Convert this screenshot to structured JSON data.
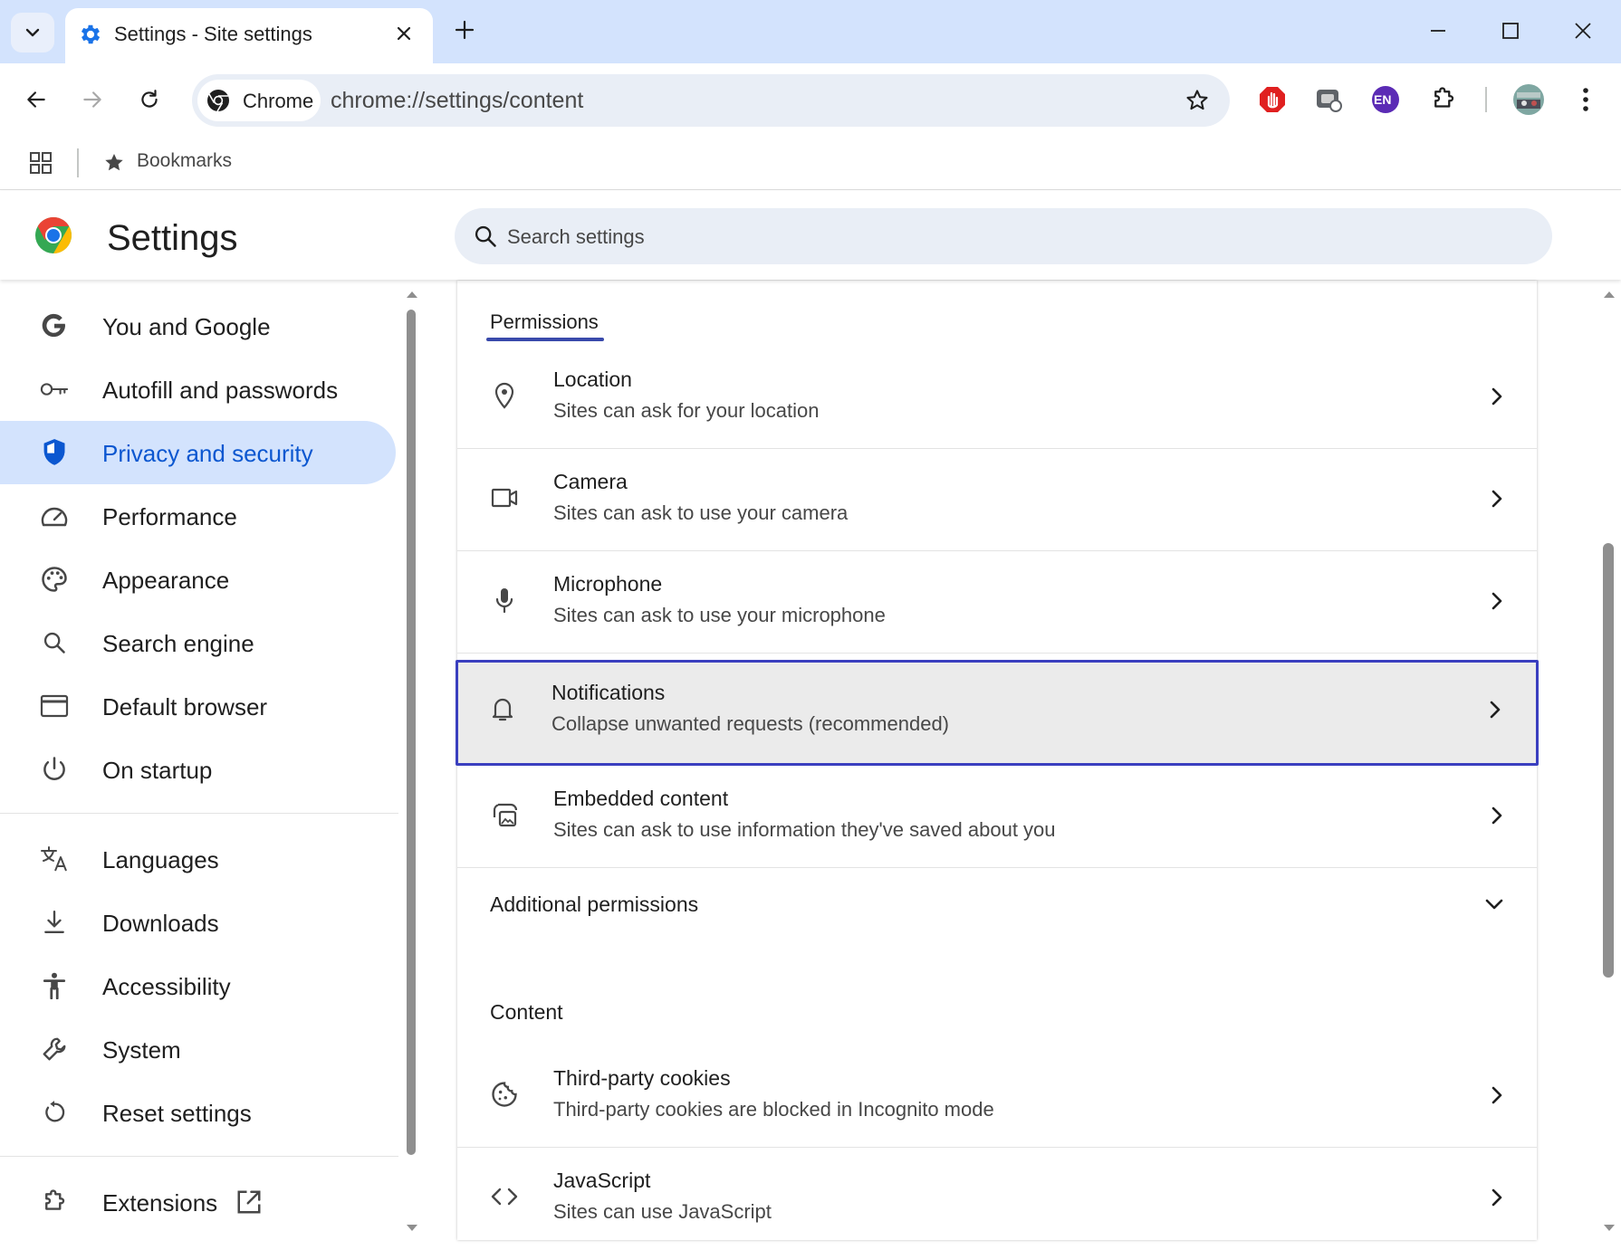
{
  "browser": {
    "tab": {
      "title": "Settings - Site settings"
    },
    "omnibox": {
      "chip_label": "Chrome",
      "url": "chrome://settings/content"
    },
    "extensions": [
      "adblock-extension",
      "screen-capture-extension",
      "language-extension",
      "extensions-puzzle"
    ],
    "language_badge": "EN",
    "bookmarks_label": "Bookmarks"
  },
  "settings": {
    "title": "Settings",
    "search_placeholder": "Search settings"
  },
  "sidebar": {
    "items": [
      {
        "label": "You and Google",
        "icon": "google-g-icon"
      },
      {
        "label": "Autofill and passwords",
        "icon": "key-icon"
      },
      {
        "label": "Privacy and security",
        "icon": "shield-icon",
        "active": true
      },
      {
        "label": "Performance",
        "icon": "speedometer-icon"
      },
      {
        "label": "Appearance",
        "icon": "palette-icon"
      },
      {
        "label": "Search engine",
        "icon": "search-icon"
      },
      {
        "label": "Default browser",
        "icon": "browser-window-icon"
      },
      {
        "label": "On startup",
        "icon": "power-icon"
      },
      {
        "label": "Languages",
        "icon": "translate-icon"
      },
      {
        "label": "Downloads",
        "icon": "download-icon"
      },
      {
        "label": "Accessibility",
        "icon": "accessibility-icon"
      },
      {
        "label": "System",
        "icon": "wrench-icon"
      },
      {
        "label": "Reset settings",
        "icon": "reset-icon"
      },
      {
        "label": "Extensions",
        "icon": "puzzle-icon"
      }
    ]
  },
  "main": {
    "permissions_heading": "Permissions",
    "permissions": [
      {
        "title": "Location",
        "subtitle": "Sites can ask for your location",
        "icon": "location-pin-icon"
      },
      {
        "title": "Camera",
        "subtitle": "Sites can ask to use your camera",
        "icon": "camera-icon"
      },
      {
        "title": "Microphone",
        "subtitle": "Sites can ask to use your microphone",
        "icon": "microphone-icon"
      },
      {
        "title": "Notifications",
        "subtitle": "Collapse unwanted requests (recommended)",
        "icon": "bell-icon",
        "highlighted": true
      },
      {
        "title": "Embedded content",
        "subtitle": "Sites can ask to use information they've saved about you",
        "icon": "embedded-content-icon"
      }
    ],
    "additional_permissions": "Additional permissions",
    "content_heading": "Content",
    "content": [
      {
        "title": "Third-party cookies",
        "subtitle": "Third-party cookies are blocked in Incognito mode",
        "icon": "cookie-icon"
      },
      {
        "title": "JavaScript",
        "subtitle": "Sites can use JavaScript",
        "icon": "code-icon"
      }
    ]
  },
  "colors": {
    "accent": "#0b57d0",
    "tabstrip": "#d3e3fd",
    "highlight_border": "#3a3fbf"
  }
}
